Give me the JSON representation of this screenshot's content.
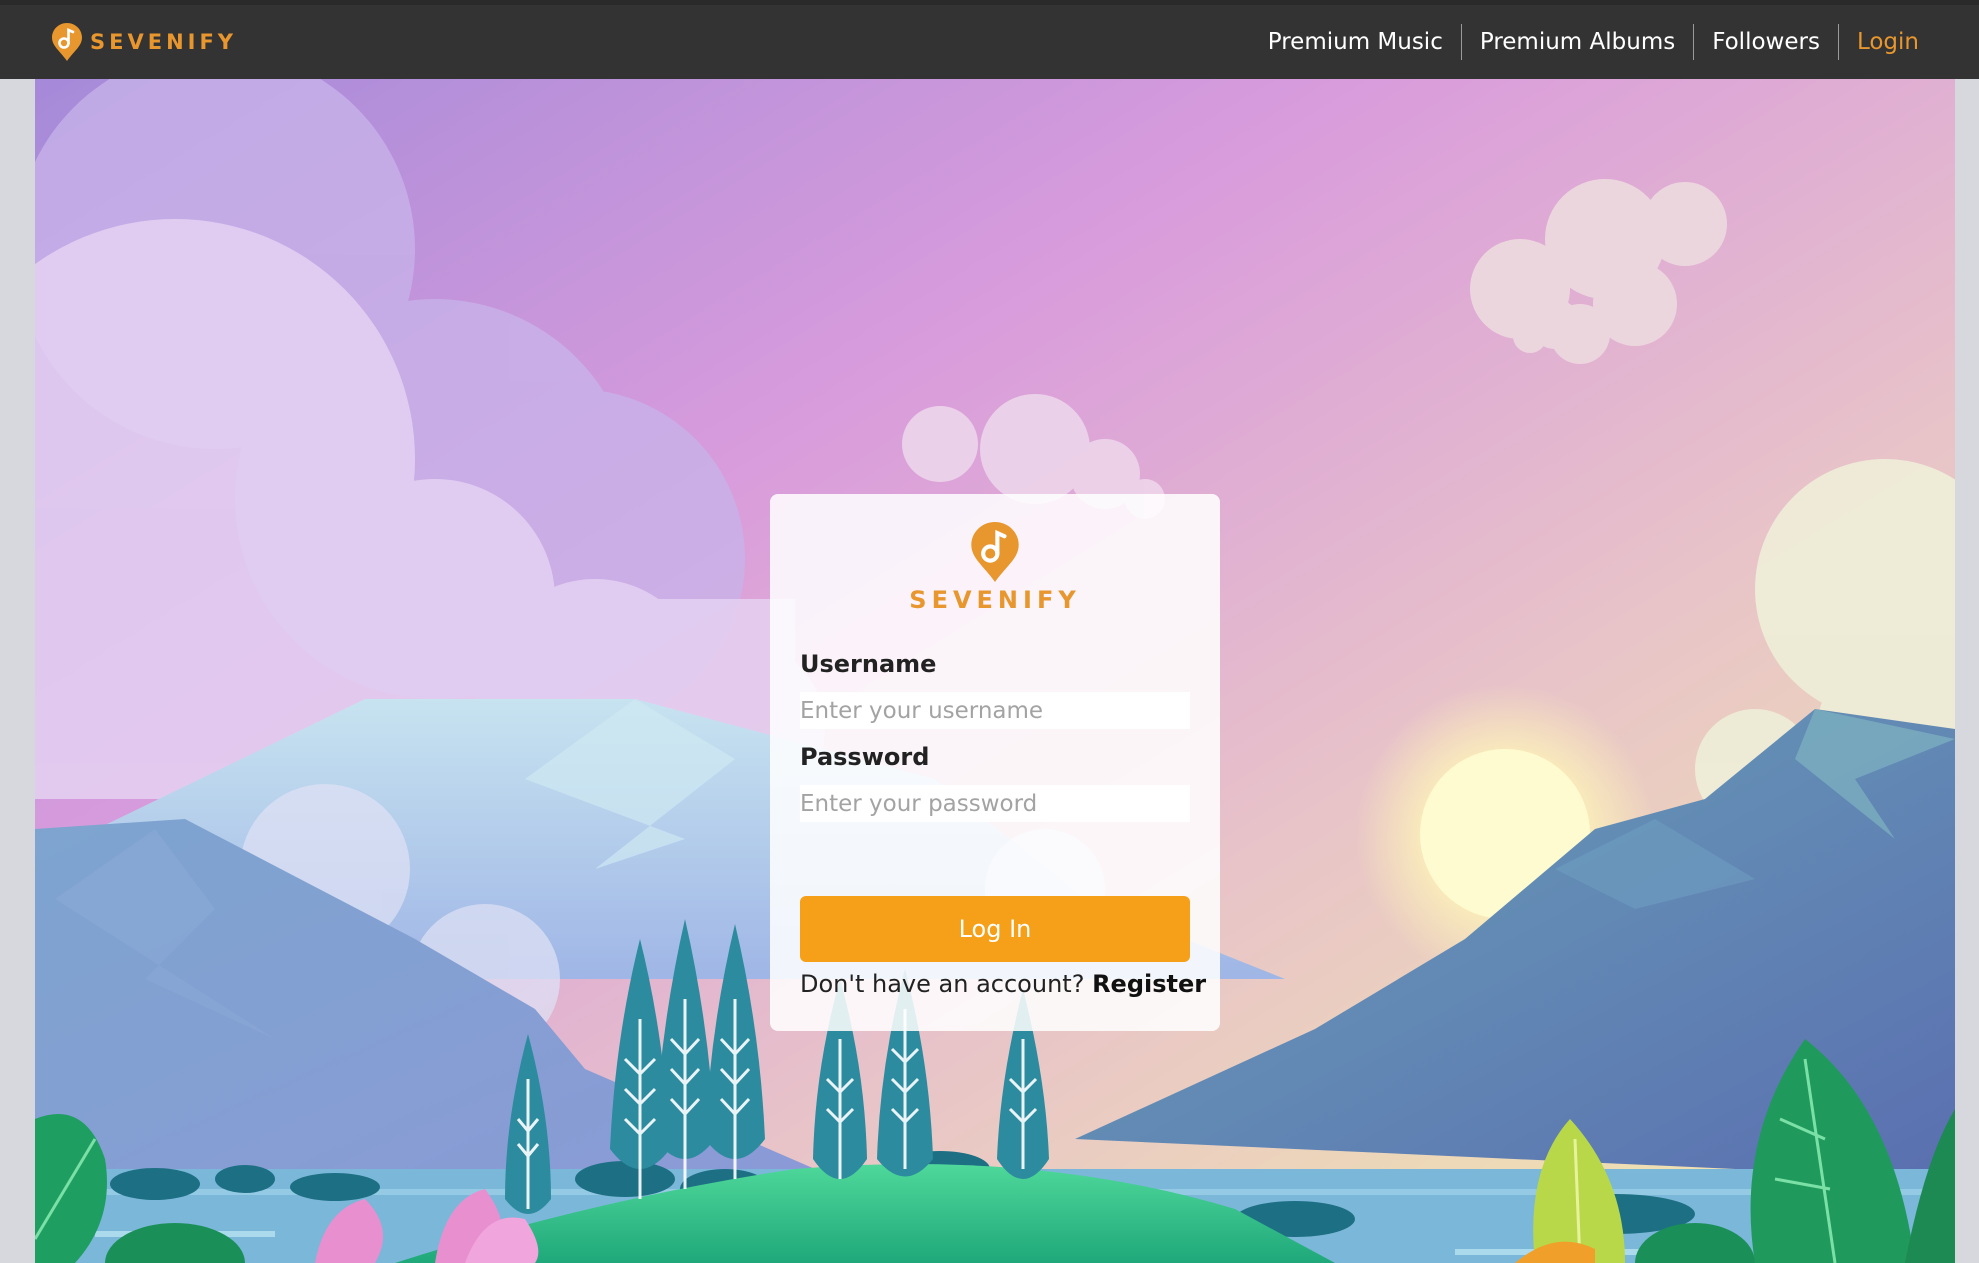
{
  "brand": {
    "name": "SEVENIFY",
    "logo_icon": "music-note-pin-icon",
    "color": "#e8962e"
  },
  "nav": {
    "items": [
      {
        "label": "Premium Music"
      },
      {
        "label": "Premium Albums"
      },
      {
        "label": "Followers"
      },
      {
        "label": "Login",
        "active": true
      }
    ],
    "active_color": "#e8962e"
  },
  "login": {
    "brand": "SEVENIFY",
    "username_label": "Username",
    "username_placeholder": "Enter your username",
    "password_label": "Password",
    "password_placeholder": "Enter your password",
    "submit_label": "Log In",
    "no_account_text": "Don't have an account?",
    "register_label": "Register",
    "button_color": "#f5a018"
  }
}
